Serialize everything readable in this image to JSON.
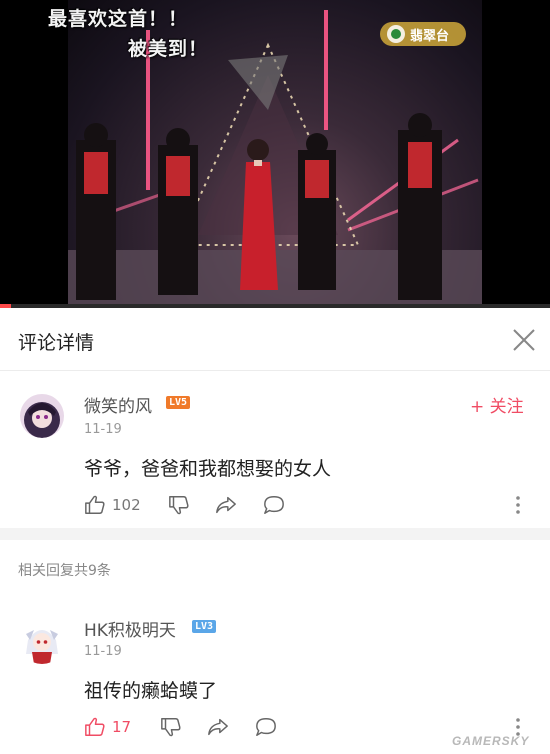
{
  "video": {
    "caption_line1": "最喜欢这首！！",
    "caption_line2": "被美到！",
    "channel_logo_text": "翡翠台",
    "progress": 0.02,
    "accent": "#ff4a4a"
  },
  "header": {
    "title": "评论详情",
    "close_icon": "close-icon"
  },
  "main_comment": {
    "username": "微笑的风",
    "level": "LV5",
    "level_color": "#f07a2a",
    "date": "11-19",
    "text": "爷爷，爸爸和我都想娶的女人",
    "follow_label": "+ 关注",
    "likes": "102",
    "liked": false
  },
  "replies_count_label": "相关回复共9条",
  "reply": {
    "username": "HK积极明天",
    "level": "LV3",
    "level_color": "#5aa6e8",
    "date": "11-19",
    "text": "祖传的癞蛤蟆了",
    "likes": "17",
    "liked": true,
    "liked_color": "#f04c64"
  },
  "watermark": "GAMERSKY"
}
